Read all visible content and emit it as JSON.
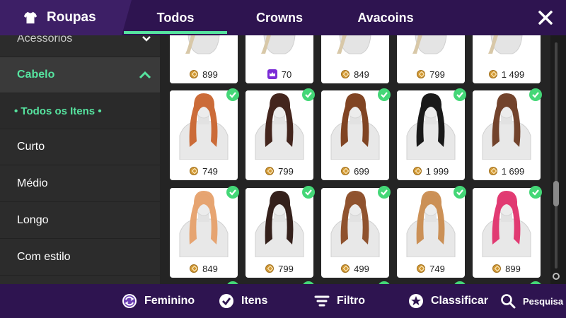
{
  "header": {
    "title": "Roupas",
    "tabs": [
      {
        "label": "Todos"
      },
      {
        "label": "Crowns"
      },
      {
        "label": "Avacoins"
      }
    ]
  },
  "sidebar": {
    "items": [
      {
        "label": "Acessórios"
      },
      {
        "label": "Cabelo"
      },
      {
        "label": "•  Todos os Itens  •"
      },
      {
        "label": "Curto"
      },
      {
        "label": "Médio"
      },
      {
        "label": "Longo"
      },
      {
        "label": "Com estilo"
      }
    ]
  },
  "grid": {
    "row0": [
      {
        "price": "899",
        "currency": "avacoin"
      },
      {
        "price": "70",
        "currency": "crown"
      },
      {
        "price": "849",
        "currency": "avacoin"
      },
      {
        "price": "799",
        "currency": "avacoin"
      },
      {
        "price": "1 499",
        "currency": "avacoin"
      }
    ],
    "row1": [
      {
        "price": "749",
        "currency": "avacoin",
        "hair": "#c9642e"
      },
      {
        "price": "799",
        "currency": "avacoin",
        "hair": "#3a1a12"
      },
      {
        "price": "699",
        "currency": "avacoin",
        "hair": "#7a3b18"
      },
      {
        "price": "1 999",
        "currency": "avacoin",
        "hair": "#0e0e0e"
      },
      {
        "price": "1 699",
        "currency": "avacoin",
        "hair": "#6b3a22"
      }
    ],
    "row2": [
      {
        "price": "849",
        "currency": "avacoin",
        "hair": "#e6a06a"
      },
      {
        "price": "799",
        "currency": "avacoin",
        "hair": "#2a1510"
      },
      {
        "price": "499",
        "currency": "avacoin",
        "hair": "#8a4a24"
      },
      {
        "price": "749",
        "currency": "avacoin",
        "hair": "#c98b4e"
      },
      {
        "price": "899",
        "currency": "avacoin",
        "hair": "#e0306c"
      }
    ]
  },
  "bottombar": {
    "feminino": "Feminino",
    "itens": "Itens",
    "filtro": "Filtro",
    "classificar": "Classificar",
    "pesquisa": "Pesquisa"
  },
  "colors": {
    "accent": "#56e39f",
    "header_bg": "#2e1450",
    "check": "#44d777"
  }
}
